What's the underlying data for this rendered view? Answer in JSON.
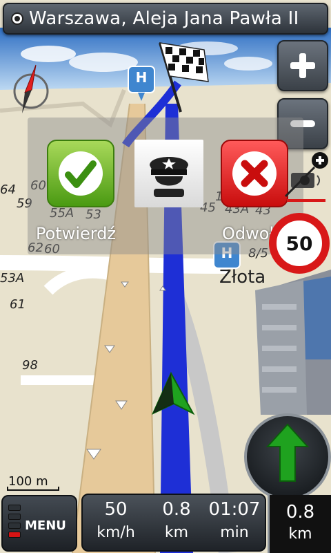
{
  "header": {
    "address": "Warszawa, Aleja Jana Pawła II",
    "location_icon": "location-dot-icon"
  },
  "zoom": {
    "in_icon": "plus-icon",
    "out_icon": "minus-icon"
  },
  "dialog": {
    "confirm_label": "Potwierdź",
    "cancel_label": "Odwołaj",
    "confirm_icon": "checkmark-icon",
    "police_icon": "police-officer-icon",
    "cancel_icon": "x-icon"
  },
  "speed_limit": {
    "value": "50"
  },
  "map_labels": {
    "street": "Złota",
    "numbers": [
      "64",
      "60",
      "59",
      "55A",
      "53",
      "45",
      "43A",
      "43",
      "8/5",
      "62",
      "60",
      "53A",
      "61",
      "98",
      "1"
    ]
  },
  "scale": {
    "text": "100 m"
  },
  "menu": {
    "label": "MENU",
    "signal_bars": 4,
    "signal_active": 1
  },
  "trip_info": {
    "speed": {
      "value": "50",
      "unit": "km/h"
    },
    "distance": {
      "value": "0.8",
      "unit": "km"
    },
    "time": {
      "value": "01:07",
      "unit": "min"
    }
  },
  "next_turn": {
    "distance": "0.8",
    "unit": "km",
    "icon": "arrow-straight-icon",
    "color": "#1fa21f"
  },
  "colors": {
    "route": "#1e2fd6",
    "speed_red": "#d81818",
    "confirm_green": "#4a9a12",
    "cancel_red": "#c90d0d"
  }
}
